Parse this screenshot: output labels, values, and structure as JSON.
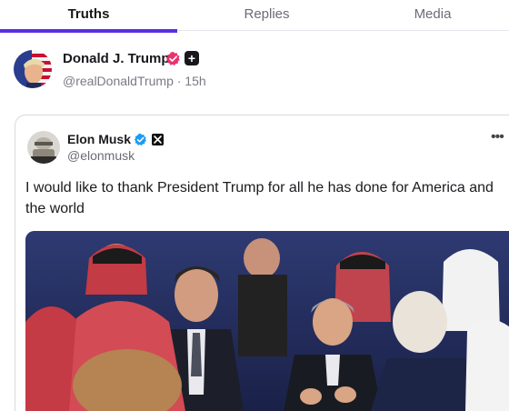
{
  "tabs": [
    {
      "label": "Truths",
      "active": true
    },
    {
      "label": "Replies",
      "active": false
    },
    {
      "label": "Media",
      "active": false
    }
  ],
  "post": {
    "author_name": "Donald J. Trump",
    "handle_time": "@realDonaldTrump · 15h",
    "avatar_icon": "trump-avatar",
    "badges": [
      "verified-icon",
      "plus-icon"
    ],
    "plus_symbol": "+"
  },
  "quote": {
    "author_name": "Elon Musk",
    "handle": "@elonmusk",
    "more_symbol": "•••",
    "text": "I would like to thank President Trump for all he has done for America and the world",
    "photo": "group-photo"
  },
  "colors": {
    "accent": "#5b2ee6",
    "verified_pink": "#e8336e",
    "verified_blue": "#1d9bf0"
  }
}
